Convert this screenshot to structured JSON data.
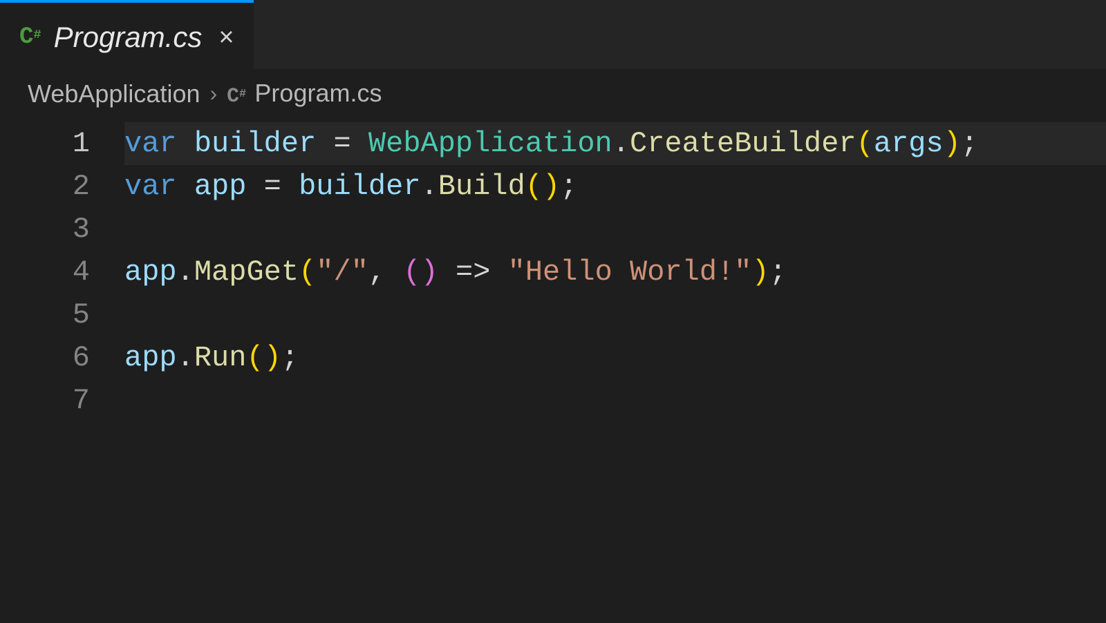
{
  "tab": {
    "icon": "csharp-icon",
    "label": "Program.cs",
    "close": "×"
  },
  "breadcrumbs": {
    "item0": "WebApplication",
    "sep": "›",
    "item1_icon": "csharp-icon",
    "item1": "Program.cs"
  },
  "editor": {
    "line_numbers": [
      "1",
      "2",
      "3",
      "4",
      "5",
      "6",
      "7"
    ],
    "active_line": 1,
    "tokens": {
      "l1": {
        "kw": "var",
        "sp": " ",
        "id": "builder",
        "eq": " = ",
        "type": "WebApplication",
        "dot": ".",
        "meth": "CreateBuilder",
        "py_o": "(",
        "arg": "args",
        "py_c": ")",
        "semi": ";"
      },
      "l2": {
        "kw": "var",
        "sp": " ",
        "id": "app",
        "eq": " = ",
        "id2": "builder",
        "dot": ".",
        "meth": "Build",
        "py_o": "(",
        "py_c": ")",
        "semi": ";"
      },
      "l3": {
        "empty": ""
      },
      "l4": {
        "id": "app",
        "dot": ".",
        "meth": "MapGet",
        "py_o": "(",
        "str1": "\"/\"",
        "comma": ", ",
        "pp_o": "(",
        "pp_c": ")",
        "arrow": " => ",
        "str2": "\"Hello World!\"",
        "py_c": ")",
        "semi": ";"
      },
      "l5": {
        "empty": ""
      },
      "l6": {
        "id": "app",
        "dot": ".",
        "meth": "Run",
        "py_o": "(",
        "py_c": ")",
        "semi": ";"
      },
      "l7": {
        "empty": ""
      }
    }
  }
}
